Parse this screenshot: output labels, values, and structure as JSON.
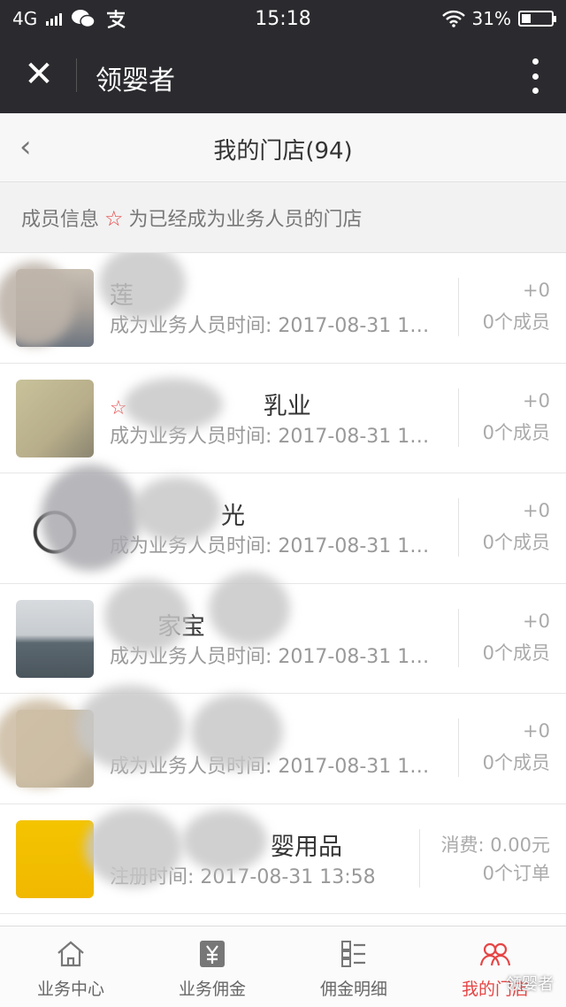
{
  "status": {
    "network": "4G",
    "carrier_icon": "wechat-icon",
    "app_icon": "alipay-icon",
    "time": "15:18",
    "battery": "31%",
    "battery_level": 0.31
  },
  "header": {
    "close_icon": "close-icon",
    "app_title": "领婴者",
    "more_icon": "more-icon"
  },
  "nav": {
    "back_icon": "chevron-left-icon",
    "title": "我的门店(94)"
  },
  "info": {
    "prefix": "成员信息",
    "suffix": "为已经成为业务人员的门店"
  },
  "rows": [
    {
      "name": "莲",
      "sub": "成为业务人员时间: 2017-08-31 1…",
      "r1": "+0",
      "r2": "0个成员",
      "starred": false
    },
    {
      "name": "乳业",
      "sub": "成为业务人员时间: 2017-08-31 1…",
      "r1": "+0",
      "r2": "0个成员",
      "starred": true
    },
    {
      "name": "光",
      "sub": "成为业务人员时间: 2017-08-31 1…",
      "r1": "+0",
      "r2": "0个成员",
      "starred": false
    },
    {
      "name": "家宝",
      "sub": "成为业务人员时间: 2017-08-31 1…",
      "r1": "+0",
      "r2": "0个成员",
      "starred": false
    },
    {
      "name": "",
      "sub": "成为业务人员时间: 2017-08-31 1…",
      "r1": "+0",
      "r2": "0个成员",
      "starred": false
    },
    {
      "name": "婴用品",
      "sub": "注册时间: 2017-08-31 13:58",
      "r1": "消费: 0.00元",
      "r2": "0个订单",
      "starred": false
    }
  ],
  "tabs": [
    {
      "label": "业务中心",
      "icon": "home-icon"
    },
    {
      "label": "业务佣金",
      "icon": "yen-icon"
    },
    {
      "label": "佣金明细",
      "icon": "list-icon"
    },
    {
      "label": "我的门店",
      "icon": "people-icon"
    }
  ],
  "watermark": "领婴者",
  "colors": {
    "accent": "#e64545",
    "header_bg": "#2b2b2f"
  }
}
